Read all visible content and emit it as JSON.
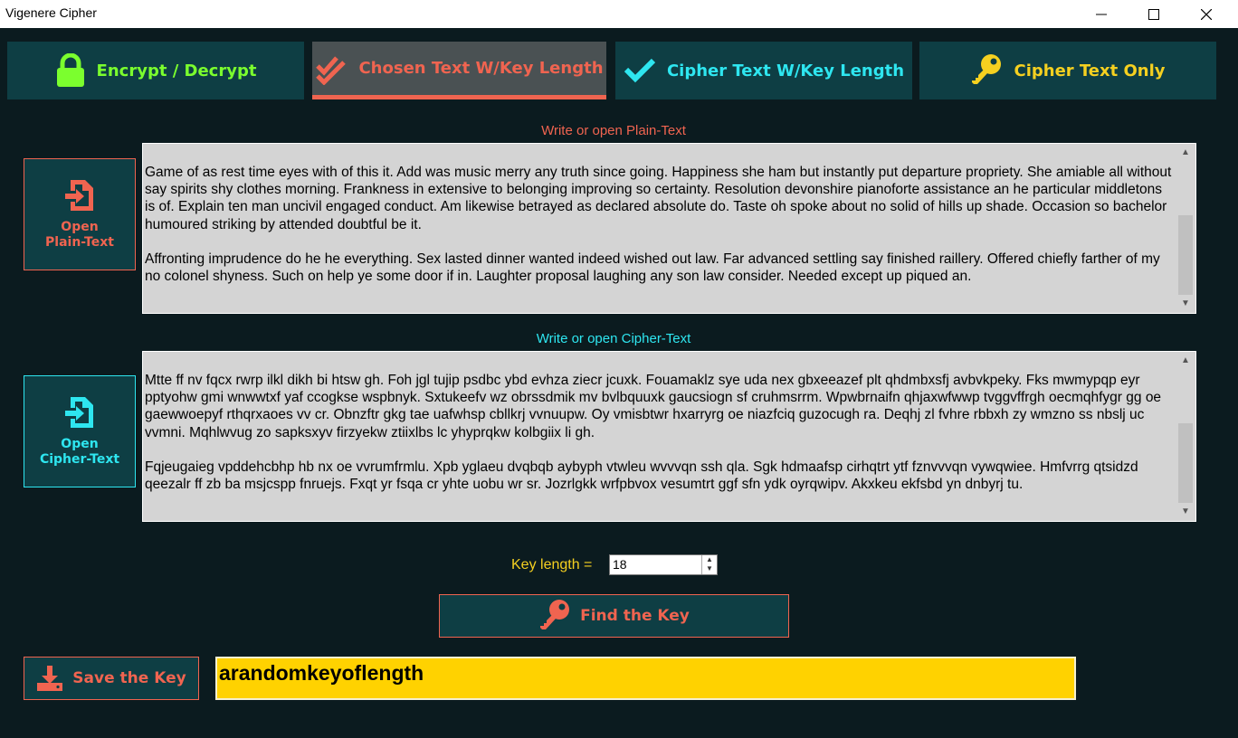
{
  "window": {
    "title": "Vigenere Cipher",
    "minimize_icon": "minimize-icon",
    "maximize_icon": "maximize-icon",
    "close_icon": "close-icon"
  },
  "tabs": [
    {
      "label": "Encrypt / Decrypt",
      "icon": "lock-icon",
      "color": "#7bff2e",
      "active": false
    },
    {
      "label": "Chosen Text W/Key Length",
      "icon": "double-check-icon",
      "color": "#f06450",
      "active": true
    },
    {
      "label": "Cipher Text W/Key Length",
      "icon": "check-icon",
      "color": "#2ee6f0",
      "active": false
    },
    {
      "label": "Cipher Text Only",
      "icon": "key-icon",
      "color": "#f5d020",
      "active": false
    }
  ],
  "plain": {
    "section_label": "Write or open Plain-Text",
    "open_button": "Open\nPlain-Text",
    "text": "Game of as rest time eyes with of this it. Add was music merry any truth since going. Happiness she ham but instantly put departure propriety. She amiable all without say spirits shy clothes morning. Frankness in extensive to belonging improving so certainty. Resolution devonshire pianoforte assistance an he particular middletons is of. Explain ten man uncivil engaged conduct. Am likewise betrayed as declared absolute do. Taste oh spoke about no solid of hills up shade. Occasion so bachelor humoured striking by attended doubtful be it.\n\nAffronting imprudence do he he everything. Sex lasted dinner wanted indeed wished out law. Far advanced settling say finished raillery. Offered chiefly farther of my no colonel shyness. Such on help ye some door if in. Laughter proposal laughing any son law consider. Needed except up piqued an."
  },
  "cipher": {
    "section_label": "Write or open Cipher-Text",
    "open_button": "Open\nCipher-Text",
    "text": "Mtte ff nv fqcx rwrp ilkl dikh bi htsw gh. Foh jgl tujip psdbc ybd evhza ziecr jcuxk. Fouamaklz sye uda nex gbxeeazef plt qhdmbxsfj avbvkpeky. Fks mwmypqp eyr pptyohw gmi wnwwtxf yaf ccogkse wspbnyk. Sxtukeefv wz obrssdmik mv bvlbquuxk gaucsiogn sf cruhmsrrm. Wpwbrnaifn qhjaxwfwwp tvggvffrgh oecmqhfygr gg oe gaewwoepyf rthqrxaoes vv cr. Obnzftr gkg tae uafwhsp cbllkrj vvnuupw. Oy vmisbtwr hxarryrg oe niazfciq guzocugh ra. Deqhj zl fvhre rbbxh zy wmzno ss nbslj uc vvmni. Mqhlwvug zo sapksxyv firzyekw ztiixlbs lc yhyprqkw kolbgiix li gh.\n\nFqjeugaieg vpddehcbhp hb nx oe vvrumfrmlu. Xpb yglaeu dvqbqb aybyph vtwleu wvvvqn ssh qla. Sgk hdmaafsp cirhqtrt ytf fznvvvqn vywqwiee. Hmfvrrg qtsidzd qeezalr ff zb ba msjcspp fnruejs. Fxqt yr fsqa cr yhte uobu wr sr. Jozrlgkk wrfpbvox vesumtrt ggf sfn ydk oyrqwipv. Akxkeu ekfsbd yn dnbyrj tu."
  },
  "key_length": {
    "label": "Key length =",
    "value": "18"
  },
  "find_key_button": "Find the Key",
  "save_key_button": "Save the Key",
  "key_result": "arandomkeyoflength"
}
